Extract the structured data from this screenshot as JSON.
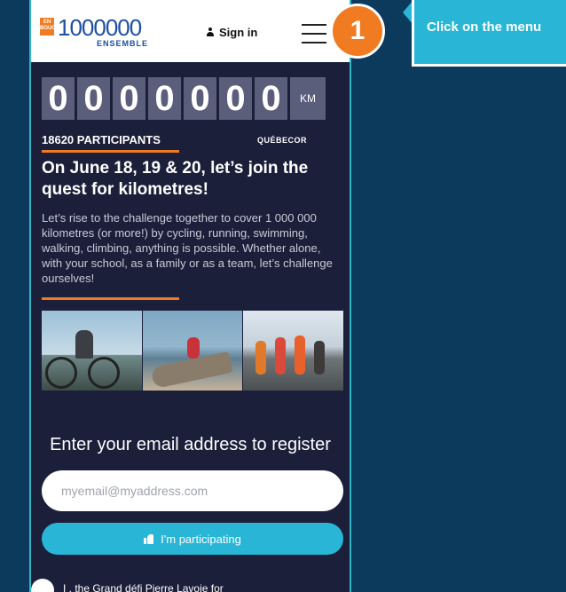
{
  "header": {
    "logo_number": "1000000",
    "logo_sub": "ENSEMBLE",
    "logo_badge": "EN BOUGE",
    "signin_label": "Sign in"
  },
  "odometer": {
    "digits": [
      "0",
      "0",
      "0",
      "0",
      "0",
      "0",
      "0"
    ],
    "unit": "KM"
  },
  "participants_label": "18620 PARTICIPANTS",
  "sponsor": "QUÉBECOR",
  "headline": "On June 18, 19 & 20, let’s join the quest for kilometres!",
  "description": "Let’s rise to the challenge together to cover 1 000 000 kilometres (or more!) by cycling, running, swimming, walking, climbing, anything is possible. Whether alone, with your school, as a family or as a team, let’s challenge ourselves!",
  "register": {
    "title": "Enter your email address to register",
    "email_placeholder": "myemail@myaddress.com",
    "button_label": "I'm participating"
  },
  "consent_text": "I , the Grand défi Pierre Lavoie for",
  "annotation": {
    "step_number": "1",
    "callout_text": "Click on the menu"
  },
  "colors": {
    "accent_orange": "#f07b20",
    "accent_cyan": "#29b6d6",
    "page_bg": "#1b1f3a",
    "outer_bg": "#0b3a5c"
  }
}
